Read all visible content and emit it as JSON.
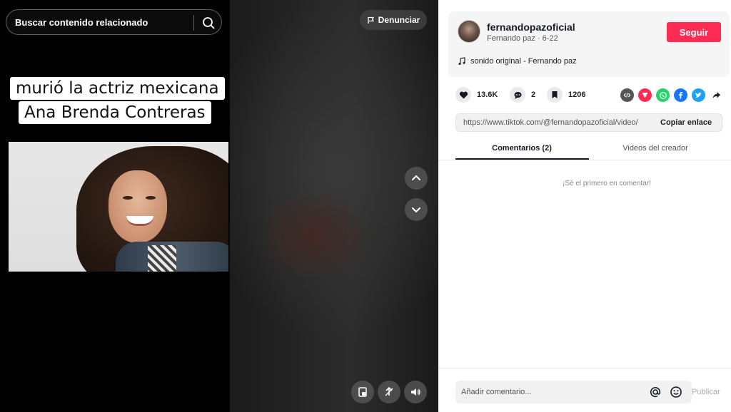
{
  "video": {
    "search_placeholder": "Buscar contenido relacionado",
    "report_label": "Denunciar",
    "caption_line1": "murió la actriz mexicana",
    "caption_line2": "Ana Brenda Contreras"
  },
  "author": {
    "username": "fernandopazoficial",
    "display_name": "Fernando paz",
    "date": "6-22",
    "follow_label": "Seguir",
    "sound": "sonido original - Fernando paz"
  },
  "stats": {
    "likes": "13.6K",
    "comments": "2",
    "saves": "1206"
  },
  "share": {
    "icons": [
      "embed-icon",
      "send-icon",
      "whatsapp-icon",
      "facebook-icon",
      "twitter-icon",
      "share-arrow-icon"
    ]
  },
  "link": {
    "url": "https://www.tiktok.com/@fernandopazoficial/video/",
    "copy_label": "Copiar enlace"
  },
  "tabs": {
    "comments": "Comentarios (2)",
    "videos": "Videos del creador"
  },
  "comments": {
    "empty_message": "¡Sé el primero en comentar!",
    "input_placeholder": "Añadir comentario...",
    "publish_label": "Publicar"
  },
  "colors": {
    "accent": "#fe2c55",
    "whatsapp": "#25d366",
    "facebook": "#1877f2",
    "twitter": "#1da1f2"
  }
}
